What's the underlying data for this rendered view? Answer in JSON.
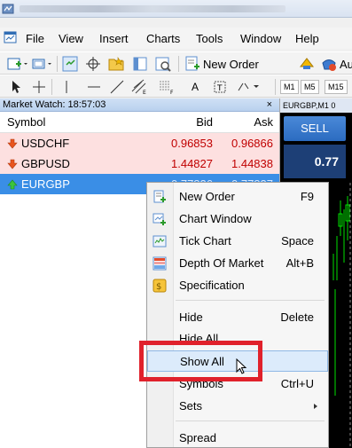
{
  "menu": {
    "file": "File",
    "view": "View",
    "insert": "Insert",
    "charts": "Charts",
    "tools": "Tools",
    "window": "Window",
    "help": "Help"
  },
  "toolbar": {
    "new_order": "New Order",
    "auto_trading_partial": "Au",
    "timeframes": [
      "M1",
      "M5",
      "M15"
    ]
  },
  "market_watch": {
    "title": "Market Watch: 18:57:03",
    "close": "×",
    "columns": {
      "symbol": "Symbol",
      "bid": "Bid",
      "ask": "Ask"
    },
    "rows": [
      {
        "symbol": "USDCHF",
        "bid": "0.96853",
        "ask": "0.96866",
        "direction": "down"
      },
      {
        "symbol": "GBPUSD",
        "bid": "1.44827",
        "ask": "1.44838",
        "direction": "down"
      },
      {
        "symbol": "EURGBP",
        "bid": "0.77826",
        "ask": "0.77837",
        "direction": "up"
      }
    ]
  },
  "chart": {
    "tab_label": "EURGBP,M1 0",
    "sell_label": "SELL",
    "price": "0.77"
  },
  "context_menu": {
    "new_order": {
      "label": "New Order",
      "shortcut": "F9"
    },
    "chart_window": {
      "label": "Chart Window"
    },
    "tick_chart": {
      "label": "Tick Chart",
      "shortcut": "Space"
    },
    "depth_of_market": {
      "label": "Depth Of Market",
      "shortcut": "Alt+B"
    },
    "specification": {
      "label": "Specification"
    },
    "hide": {
      "label": "Hide",
      "shortcut": "Delete"
    },
    "hide_all": {
      "label": "Hide All"
    },
    "show_all": {
      "label": "Show All"
    },
    "symbols": {
      "label": "Symbols",
      "shortcut": "Ctrl+U"
    },
    "sets": {
      "label": "Sets"
    },
    "spread": {
      "label": "Spread"
    }
  },
  "colors": {
    "highlight": "#e0212b",
    "selection": "#3a8ee6",
    "down_row": "#fde0e0",
    "price_text_down": "#c00000"
  }
}
